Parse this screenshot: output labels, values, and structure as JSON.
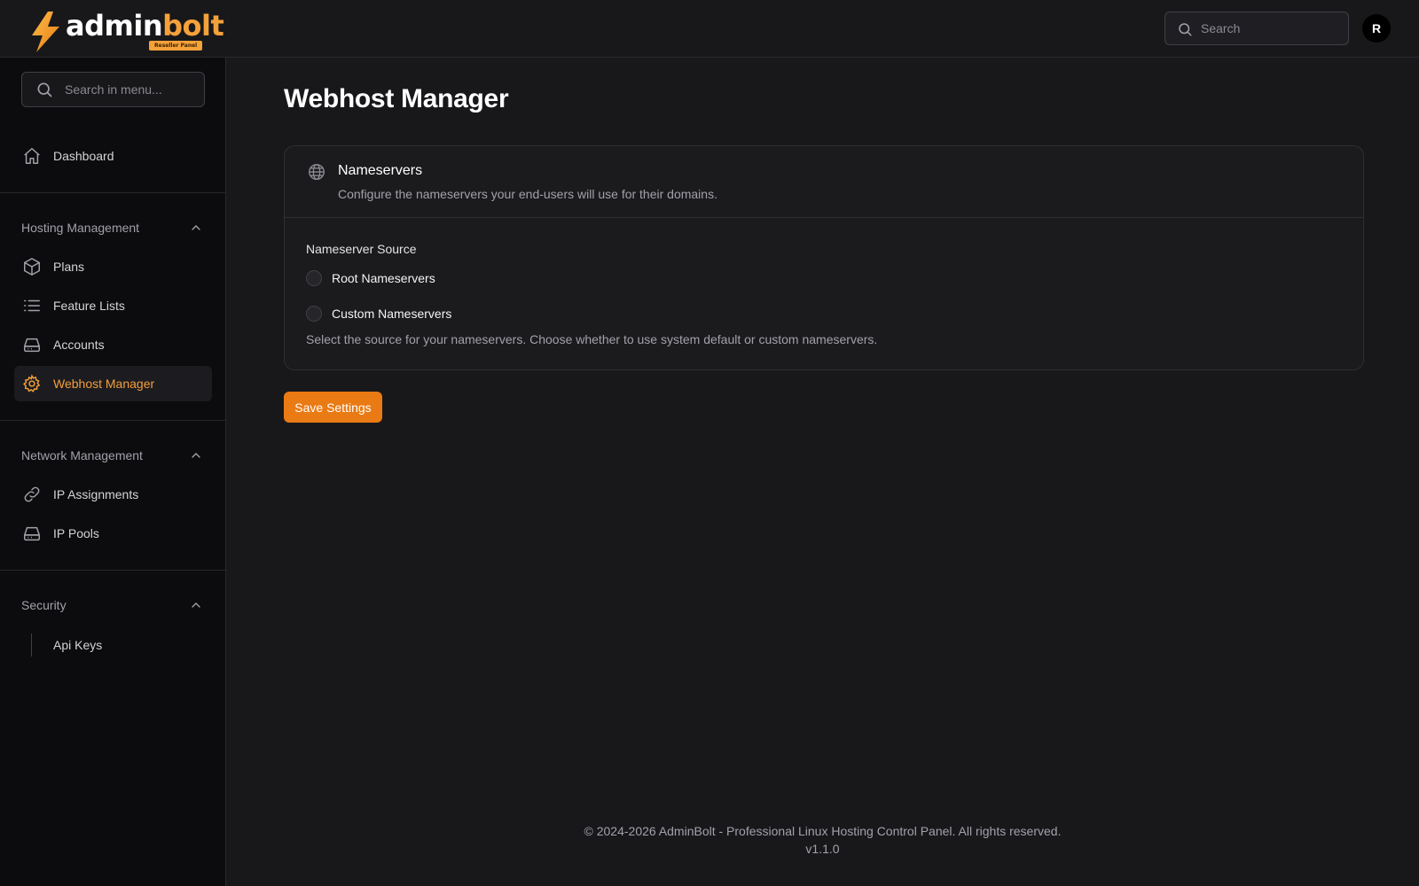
{
  "brand": {
    "name_part1": "admin",
    "name_part2": "bolt",
    "badge": "Reseller Panel",
    "accent_color": "#f5a13a"
  },
  "header": {
    "search_placeholder": "Search",
    "avatar_initial": "R"
  },
  "sidebar": {
    "search_placeholder": "Search in menu...",
    "dashboard": {
      "label": "Dashboard",
      "icon": "home-icon"
    },
    "groups": [
      {
        "title": "Hosting Management",
        "items": [
          {
            "label": "Plans",
            "icon": "box-icon"
          },
          {
            "label": "Feature Lists",
            "icon": "list-icon"
          },
          {
            "label": "Accounts",
            "icon": "hard-drive-icon"
          },
          {
            "label": "Webhost Manager",
            "icon": "gear-icon",
            "active": true
          }
        ]
      },
      {
        "title": "Network Management",
        "items": [
          {
            "label": "IP Assignments",
            "icon": "link-icon"
          },
          {
            "label": "IP Pools",
            "icon": "hard-drive-icon"
          }
        ]
      },
      {
        "title": "Security",
        "items": [
          {
            "label": "Api Keys"
          }
        ]
      }
    ]
  },
  "main": {
    "title": "Webhost Manager",
    "card": {
      "title": "Nameservers",
      "description": "Configure the nameservers your end-users will use for their domains.",
      "field_label": "Nameserver Source",
      "options": [
        "Root Nameservers",
        "Custom Nameservers"
      ],
      "helper": "Select the source for your nameservers. Choose whether to use system default or custom nameservers."
    },
    "save_label": "Save Settings"
  },
  "footer": {
    "copyright": "© 2024-2026 AdminBolt - Professional Linux Hosting Control Panel. All rights reserved.",
    "version": "v1.1.0"
  }
}
